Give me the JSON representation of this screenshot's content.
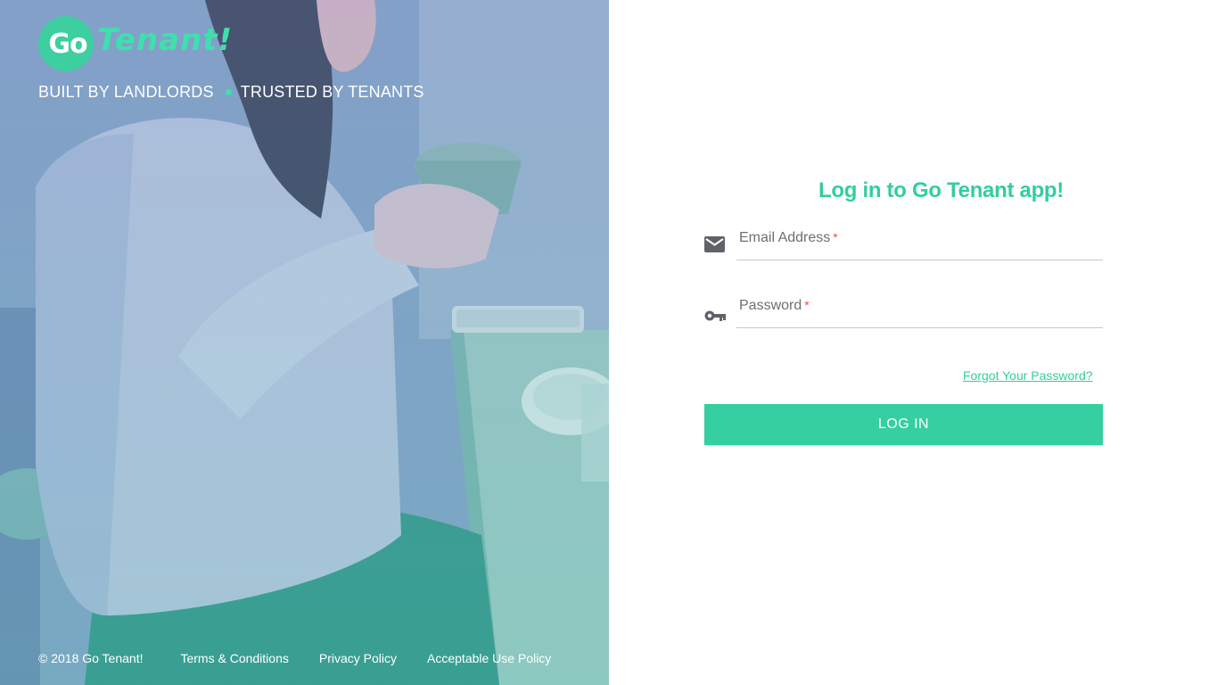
{
  "brand": {
    "logo_go": "Go",
    "logo_word": "Tenant!",
    "tagline_left": "BUILT BY LANDLORDS",
    "tagline_right": "TRUSTED BY TENANTS"
  },
  "footer": {
    "copyright": "© 2018 Go Tenant!",
    "links": [
      "Terms & Conditions",
      "Privacy Policy",
      "Acceptable Use Policy"
    ]
  },
  "login": {
    "title": "Log in to Go Tenant app!",
    "email_label": "Email Address",
    "password_label": "Password",
    "required_mark": "*",
    "forgot_link": "Forgot Your Password?",
    "submit_label": "LOG IN",
    "email_icon": "envelope-icon",
    "password_icon": "key-icon"
  },
  "colors": {
    "accent": "#35cfa1",
    "required": "#f04b4b"
  }
}
